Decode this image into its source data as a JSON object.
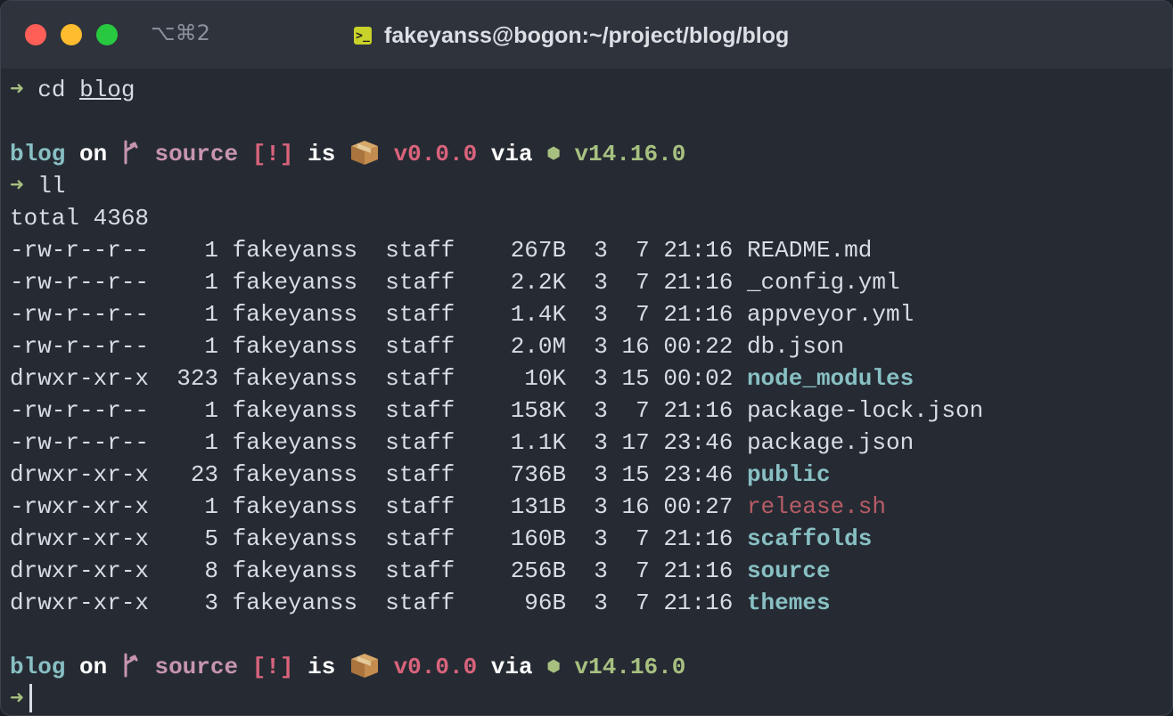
{
  "window": {
    "shortcut": "⌥⌘2",
    "title": "fakeyanss@bogon:~/project/blog/blog"
  },
  "colors": {
    "titlebar": "#2e333c",
    "background": "#262b33",
    "prompt_arrow": "#a7c080",
    "directory": "#88c0c4",
    "branch": "#c795ae",
    "version": "#d9637c",
    "executable": "#b85c67",
    "traffic_red": "#ff5f57",
    "traffic_yellow": "#febc2e",
    "traffic_green": "#28c840"
  },
  "icons": {
    "terminal": "terminal-icon",
    "branch": "git-branch-icon",
    "package": "package-box-icon",
    "node": "node-hexagon-icon"
  },
  "terminal": {
    "arrow": "➜",
    "cmd1": {
      "name": "cd",
      "arg": "blog"
    },
    "prompt": {
      "dir": "blog",
      "on": "on",
      "branch_glyph": "",
      "branch": "source",
      "status": "[!]",
      "is": "is",
      "version": "v0.0.0",
      "via": "via",
      "node_glyph": "⬢",
      "node_version": "v14.16.0"
    },
    "cmd2": "ll",
    "total": "total 4368",
    "listing": [
      {
        "perms": "-rw-r--r--",
        "links": "1",
        "owner": "fakeyanss",
        "group": "staff",
        "size": "267B",
        "month": "3",
        "day": "7",
        "time": "21:16",
        "name": "README.md",
        "kind": "file"
      },
      {
        "perms": "-rw-r--r--",
        "links": "1",
        "owner": "fakeyanss",
        "group": "staff",
        "size": "2.2K",
        "month": "3",
        "day": "7",
        "time": "21:16",
        "name": "_config.yml",
        "kind": "file"
      },
      {
        "perms": "-rw-r--r--",
        "links": "1",
        "owner": "fakeyanss",
        "group": "staff",
        "size": "1.4K",
        "month": "3",
        "day": "7",
        "time": "21:16",
        "name": "appveyor.yml",
        "kind": "file"
      },
      {
        "perms": "-rw-r--r--",
        "links": "1",
        "owner": "fakeyanss",
        "group": "staff",
        "size": "2.0M",
        "month": "3",
        "day": "16",
        "time": "00:22",
        "name": "db.json",
        "kind": "file"
      },
      {
        "perms": "drwxr-xr-x",
        "links": "323",
        "owner": "fakeyanss",
        "group": "staff",
        "size": "10K",
        "month": "3",
        "day": "15",
        "time": "00:02",
        "name": "node_modules",
        "kind": "dir"
      },
      {
        "perms": "-rw-r--r--",
        "links": "1",
        "owner": "fakeyanss",
        "group": "staff",
        "size": "158K",
        "month": "3",
        "day": "7",
        "time": "21:16",
        "name": "package-lock.json",
        "kind": "file"
      },
      {
        "perms": "-rw-r--r--",
        "links": "1",
        "owner": "fakeyanss",
        "group": "staff",
        "size": "1.1K",
        "month": "3",
        "day": "17",
        "time": "23:46",
        "name": "package.json",
        "kind": "file"
      },
      {
        "perms": "drwxr-xr-x",
        "links": "23",
        "owner": "fakeyanss",
        "group": "staff",
        "size": "736B",
        "month": "3",
        "day": "15",
        "time": "23:46",
        "name": "public",
        "kind": "dir"
      },
      {
        "perms": "-rwxr-xr-x",
        "links": "1",
        "owner": "fakeyanss",
        "group": "staff",
        "size": "131B",
        "month": "3",
        "day": "16",
        "time": "00:27",
        "name": "release.sh",
        "kind": "exec"
      },
      {
        "perms": "drwxr-xr-x",
        "links": "5",
        "owner": "fakeyanss",
        "group": "staff",
        "size": "160B",
        "month": "3",
        "day": "7",
        "time": "21:16",
        "name": "scaffolds",
        "kind": "dir"
      },
      {
        "perms": "drwxr-xr-x",
        "links": "8",
        "owner": "fakeyanss",
        "group": "staff",
        "size": "256B",
        "month": "3",
        "day": "7",
        "time": "21:16",
        "name": "source",
        "kind": "dir"
      },
      {
        "perms": "drwxr-xr-x",
        "links": "3",
        "owner": "fakeyanss",
        "group": "staff",
        "size": "96B",
        "month": "3",
        "day": "7",
        "time": "21:16",
        "name": "themes",
        "kind": "dir"
      }
    ]
  }
}
